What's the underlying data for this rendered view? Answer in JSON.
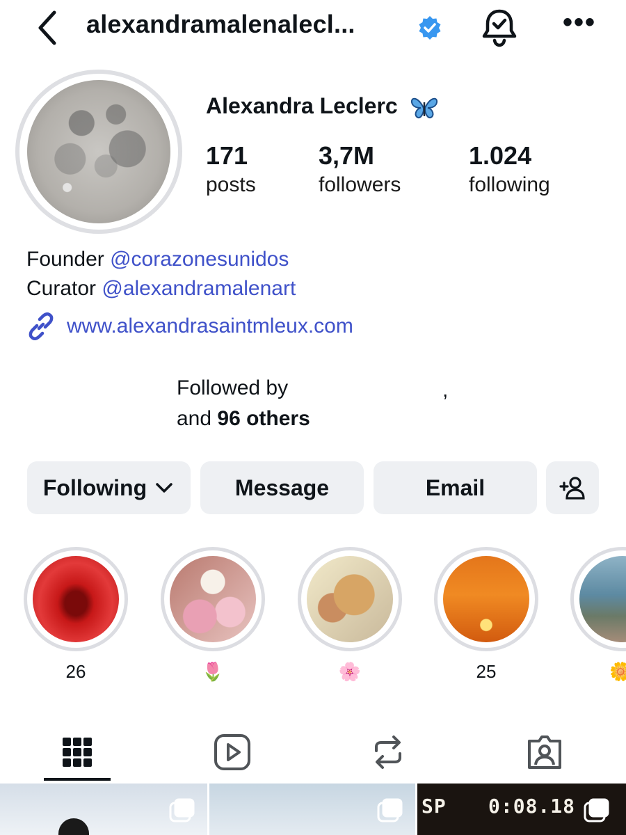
{
  "header": {
    "username": "alexandramalenalecl...",
    "back_icon": "chevron-left-icon",
    "verified_icon": "verified-badge-icon",
    "bell_icon": "bell-check-icon",
    "more_label": "•••"
  },
  "profile": {
    "display_name": "Alexandra Leclerc",
    "name_emoji": "butterfly-icon",
    "avatar": "moon-photo",
    "stats": {
      "posts_count": "171",
      "posts_label": "posts",
      "followers_count": "3,7M",
      "followers_label": "followers",
      "following_count": "1.024",
      "following_label": "following"
    }
  },
  "bio": {
    "line1_prefix": "Founder ",
    "line1_mention": "@corazonesunidos",
    "line2_prefix": "Curator ",
    "line2_mention": "@alexandramalenart",
    "link": "www.alexandrasaintmleux.com",
    "link_icon": "link-icon"
  },
  "followed_by": {
    "line1": "Followed by",
    "comma": ",",
    "line2_prefix": "and ",
    "line2_bold": "96 others"
  },
  "actions": {
    "following_label": "Following",
    "message_label": "Message",
    "email_label": "Email",
    "add_user_icon": "add-person-icon"
  },
  "highlights": [
    {
      "label": "26",
      "image": "red-eye"
    },
    {
      "label": "🌷",
      "image": "pink-flowers-table"
    },
    {
      "label": "🌸",
      "image": "sleeping-puppy"
    },
    {
      "label": "25",
      "image": "sunset"
    },
    {
      "label": "🌼",
      "image": "lake-view"
    }
  ],
  "tabs": [
    {
      "name": "posts-grid",
      "icon": "grid-icon"
    },
    {
      "name": "reels",
      "icon": "reels-icon"
    },
    {
      "name": "reposts",
      "icon": "repost-icon"
    },
    {
      "name": "tagged",
      "icon": "tagged-icon"
    }
  ],
  "grid_preview": {
    "thumb3_text_left": "SP",
    "thumb3_text_right": "0:08.18"
  },
  "colors": {
    "link_blue": "#3f51c9",
    "button_bg": "#eef0f3",
    "verified_blue": "#3897f0"
  }
}
